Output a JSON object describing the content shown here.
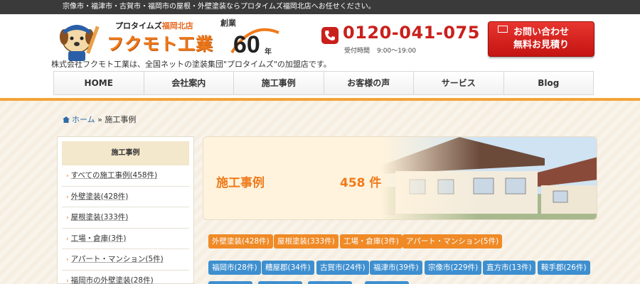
{
  "topbar": {
    "text": "宗像市・福津市・古賀市・福岡市の屋根・外壁塗装ならプロタイムズ福岡北店へお任せください。"
  },
  "header": {
    "logo_sub_prefix": "プロタイムズ",
    "logo_sub_branch": "福岡北店",
    "logo_main": "フクモト工業",
    "sougyou": "創業",
    "years": "60",
    "nen": "年",
    "company_note": "株式会社フクモト工業は、全国ネットの塗装集団\"プロタイムズ\"の加盟店です。",
    "phone": "0120-041-075",
    "hours_label": "受付時間",
    "hours_value": "9:00〜19:00",
    "cta_line1": "お問い合わせ",
    "cta_line2": "無料お見積り"
  },
  "nav": [
    {
      "label": "HOME"
    },
    {
      "label": "会社案内"
    },
    {
      "label": "施工事例"
    },
    {
      "label": "お客様の声"
    },
    {
      "label": "サービス"
    },
    {
      "label": "Blog"
    }
  ],
  "breadcrumb": {
    "home": "ホーム",
    "sep": "»",
    "current": "施工事例"
  },
  "sidebar": {
    "heading": "施工事例",
    "items": [
      {
        "label": "すべての施工事例(458件)"
      },
      {
        "label": "外壁塗装(428件)"
      },
      {
        "label": "屋根塗装(333件)"
      },
      {
        "label": "工場・倉庫(3件)"
      },
      {
        "label": "アパート・マンション(5件)"
      },
      {
        "label": "福岡市の外壁塗装(28件)"
      }
    ]
  },
  "hero": {
    "title": "施工事例",
    "count": "458 件"
  },
  "tags_category": [
    {
      "label": "外壁塗装(428件)"
    },
    {
      "label": "屋根塗装(333件)"
    },
    {
      "label": "工場・倉庫(3件)"
    },
    {
      "label": "アパート・マンション(5件)"
    }
  ],
  "tags_area": [
    {
      "label": "福岡市(28件)"
    },
    {
      "label": "糟屋郡(34件)"
    },
    {
      "label": "古賀市(24件)"
    },
    {
      "label": "福津市(39件)"
    },
    {
      "label": "宗像市(229件)"
    },
    {
      "label": "直方市(13件)"
    },
    {
      "label": "鞍手郡(26件)"
    }
  ],
  "colors": {
    "accent_orange": "#ef7a1a",
    "phone_red": "#c9201c",
    "tag_blue": "#3e8fcf",
    "nav_border": "#f3a33a"
  }
}
